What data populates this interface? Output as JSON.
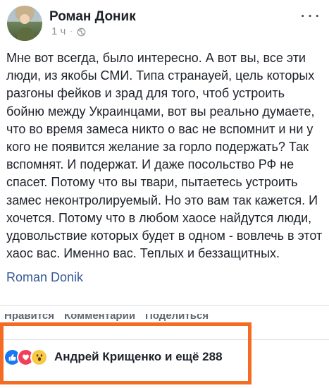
{
  "post": {
    "author": "Роман Доник",
    "time": "1 ч",
    "dot": "·",
    "more_label": "···",
    "body": "Мне вот всегда, было интересно. А вот вы, все эти люди, из якобы СМИ. Типа странауей, цель которых разгоны фейков и зрад для того, чтоб устроить бойню между Украинцами, вот вы реально думаете, что во время замеса никто о вас не вспомнит и ни у кого не появится желание за горло подержать? Так вспомнят. И подержат. И даже посольство РФ не спасет. Потому что вы твари, пытаетесь устроить замес неконтролируемый. Но это вам так кажется. И хочется. Потому что в любом хаосе найдутся люди, удовольствие которых будет в одном - вовлечь в этот хаос вас. Именно вас. Теплых и беззащитных.",
    "signature_link": "Roman Donik"
  },
  "actions": {
    "like": "Нравится",
    "comment": "Комментарий",
    "share": "Поделиться"
  },
  "reactions": {
    "icons": [
      "like-icon",
      "love-icon",
      "wow-icon"
    ],
    "summary": "Андрей Крищенко и ещё 288"
  },
  "colors": {
    "link": "#365899",
    "highlight": "#f36c22",
    "like": "#1877f2",
    "love": "#f33e58",
    "wow": "#f7c948"
  }
}
